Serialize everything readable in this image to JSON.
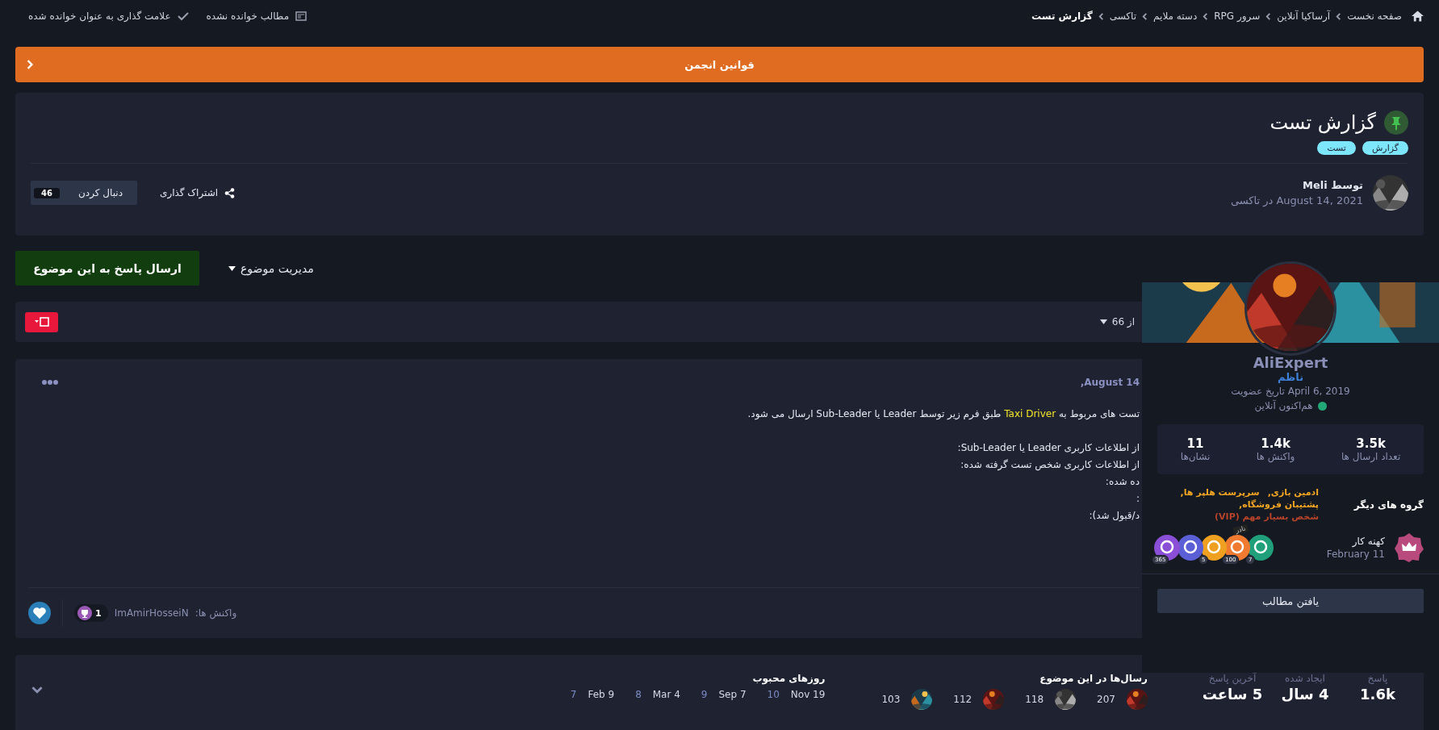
{
  "top_bar": {
    "breadcrumbs": [
      {
        "label": "صفحه نخست",
        "current": false
      },
      {
        "label": "آرساکیا آنلاین",
        "current": false
      },
      {
        "label": "سرور RPG",
        "current": false
      },
      {
        "label": "دسته ملایم",
        "current": false
      },
      {
        "label": "تاکسی",
        "current": false
      },
      {
        "label": "گزارش تست",
        "current": true
      }
    ],
    "links": [
      {
        "label": "مطالب خوانده نشده",
        "kind": "unread"
      },
      {
        "label": "علامت گذاری به عنوان خوانده شده",
        "kind": "mark"
      }
    ]
  },
  "announcement": {
    "label": "قوانین انجمن"
  },
  "topic": {
    "title": "گزارش تست",
    "pinned": true,
    "tags": [
      "گزارش",
      "تست"
    ],
    "author": "توسط Meli",
    "meta": "August 14, 2021 در تاکسی",
    "share": "اشتراک گذاری",
    "follow": {
      "label": "دنبال کردن",
      "count": "46"
    }
  },
  "actions": {
    "reply": "ارسال پاسخ به این موضوع",
    "manage": "مدیریت موضوع"
  },
  "pagination": {
    "label": "از 66"
  },
  "post": {
    "date": "August 14,",
    "paragraphs": [
      {
        "lines": [
          {
            "segments": [
              {
                "text": "تست های مربوط به ",
                "highlight": false
              },
              {
                "text": "Taxi Driver",
                "highlight": true
              },
              {
                "text": " طبق فرم زیر توسط Leader یا Sub-Leader ارسال می شود.",
                "highlight": false
              }
            ]
          }
        ]
      },
      {
        "lines": [
          {
            "segments": [
              {
                "text": "از اطلاعات کاربری Leader یا Sub-Leader:",
                "highlight": false
              }
            ]
          },
          {
            "segments": [
              {
                "text": "از اطلاعات کاربری شخص تست گرفته شده:",
                "highlight": false
              }
            ]
          },
          {
            "segments": [
              {
                "text": "ده شده:",
                "highlight": false
              }
            ]
          },
          {
            "segments": [
              {
                "text": ":",
                "highlight": false
              }
            ]
          },
          {
            "segments": [
              {
                "text": "د/قبول شد):",
                "highlight": false
              }
            ]
          }
        ]
      }
    ],
    "reactions_label": "واکنش ها:",
    "reactor": "ImAmirHosseiN",
    "reaction_count": "1"
  },
  "topic_stats": [
    {
      "label": "پاسخ",
      "value": "1.6k"
    },
    {
      "label": "ایجاد شده",
      "value": "4 سال"
    },
    {
      "label": "آخرین پاسخ",
      "value": "5 ساعت"
    }
  ],
  "top_posters": {
    "title": "رسال‌ها در این موضوع",
    "entries": [
      {
        "count": "207"
      },
      {
        "count": "118"
      },
      {
        "count": "112"
      },
      {
        "count": "103"
      }
    ]
  },
  "popular_days": {
    "title": "روزهای محبوب",
    "entries": [
      {
        "date": "Nov 19",
        "count": "10"
      },
      {
        "date": "Sep 7",
        "count": "9"
      },
      {
        "date": "Mar 4",
        "count": "8"
      },
      {
        "date": "Feb 9",
        "count": "7"
      }
    ]
  },
  "profile_card": {
    "name": "AliExpert",
    "role": "ناظم",
    "joined": "April 6, 2019 تاریخ عضویت",
    "status": "هم‌اکنون آنلاین",
    "online": true,
    "stats": [
      {
        "value": "3.5k",
        "label": "تعداد ارسال ها"
      },
      {
        "value": "1.4k",
        "label": "واکنش ها"
      },
      {
        "value": "11",
        "label": "نشان‌ها"
      }
    ],
    "groups_label": "گروه های دیگر",
    "groups": [
      {
        "name": "ادمین بازی,",
        "color": "#f5a623"
      },
      {
        "name": "سرپرست هلپر ها,",
        "color": "#f5a623"
      },
      {
        "name": "پشتیبان فروشگاه,",
        "color": "#f5a623"
      },
      {
        "name": "شخص بسیار مهم (VIP)",
        "color": "#b8432b"
      }
    ],
    "rank": {
      "title": "کهنه کار",
      "date": "February 11"
    },
    "badges": [
      {
        "color": "#1fa07a",
        "count": "7"
      },
      {
        "color": "#f07a30",
        "count": "100",
        "ribbon": "نادر"
      },
      {
        "color": "#f0a020",
        "count": "5"
      },
      {
        "color": "#5b5fd6"
      },
      {
        "color": "#8a4fd6",
        "count": "365"
      }
    ],
    "button": "یافتن مطالب"
  }
}
